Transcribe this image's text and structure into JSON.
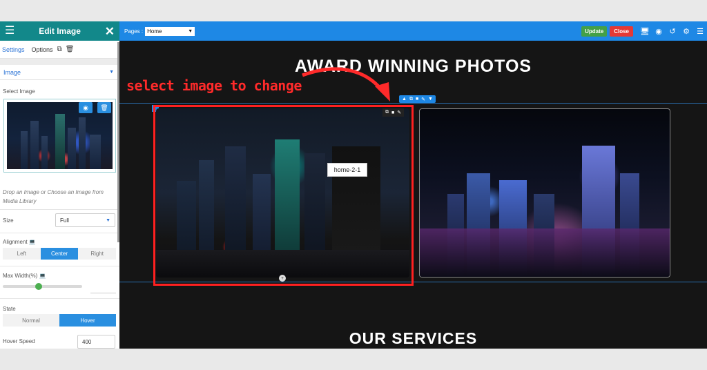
{
  "panel": {
    "title": "Edit Image",
    "tabs": [
      "Settings",
      "Options"
    ],
    "section": "Image",
    "select_image_label": "Select Image",
    "drop_hint": "Drop an Image or Choose an Image from Media Library",
    "size_label": "Size",
    "size_value": "Full",
    "alignment_label": "Alignment",
    "alignment_options": [
      "Left",
      "Center",
      "Right"
    ],
    "alignment_selected": "Center",
    "max_width_label": "Max Width(%)",
    "max_width_slider": 0.45,
    "state_label": "State",
    "state_options": [
      "Normal",
      "Hover"
    ],
    "state_selected": "Hover",
    "hover_speed_label": "Hover Speed",
    "hover_speed_value": "400"
  },
  "topbar": {
    "pages_label": "Pages :",
    "pages_value": "Home",
    "update_label": "Update",
    "close_label": "Close",
    "icons": [
      "desktop-icon",
      "eye-icon",
      "history-icon",
      "settings-icon",
      "sitemap-icon"
    ]
  },
  "canvas": {
    "award_title": "AWARD WINNING PHOTOS",
    "annotation": "select image to change",
    "image_alt": "home-2-1",
    "services_title": "OUR SERVICES"
  },
  "colors": {
    "panel_header": "#12888a",
    "topbar": "#1e88e5",
    "update": "#43a047",
    "close": "#e53935",
    "annotation": "#ff2a2a",
    "accent": "#2a8fe0"
  }
}
